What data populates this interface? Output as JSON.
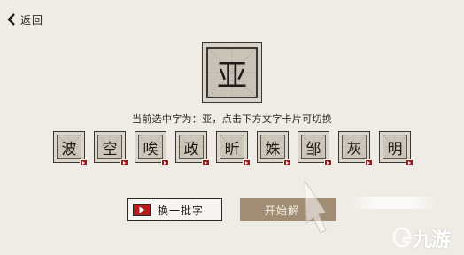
{
  "header": {
    "back_label": "返回"
  },
  "selected": {
    "character": "亚"
  },
  "hint_text": "当前选中字为：亚，点击下方文字卡片可切换",
  "tiles": [
    {
      "char": "波"
    },
    {
      "char": "空"
    },
    {
      "char": "唉"
    },
    {
      "char": "政"
    },
    {
      "char": "昕"
    },
    {
      "char": "姝"
    },
    {
      "char": "邹"
    },
    {
      "char": "灰"
    },
    {
      "char": "明"
    }
  ],
  "buttons": {
    "swap_label": "换一批字",
    "start_label": "开始解"
  },
  "watermark": {
    "text": "九游"
  },
  "colors": {
    "background": "#efece6",
    "badge_red": "#a01919",
    "start_button": "#a08d73"
  }
}
